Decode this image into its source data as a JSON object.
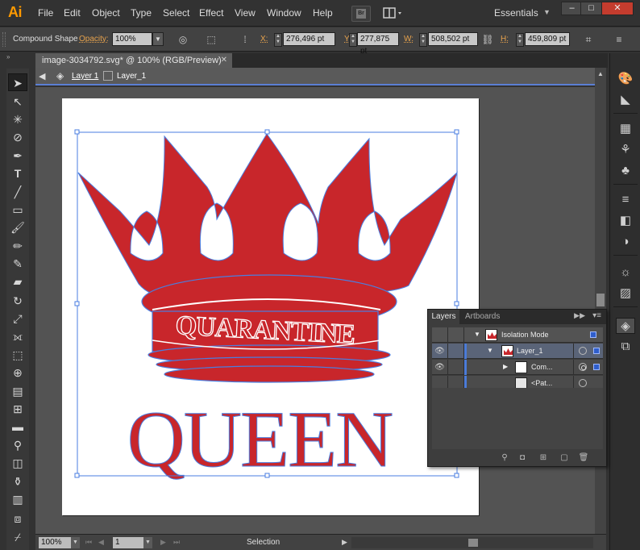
{
  "app": {
    "logo": "Ai"
  },
  "menu": [
    "File",
    "Edit",
    "Object",
    "Type",
    "Select",
    "Effect",
    "View",
    "Window",
    "Help"
  ],
  "bridge_button": "Br",
  "workspace": "Essentials",
  "window_controls": {
    "minimize": "–",
    "maximize": "□",
    "close": "✕"
  },
  "control": {
    "selection_type": "Compound Shape",
    "opacity_label": "Opacity:",
    "opacity_value": "100%",
    "x_label": "X:",
    "x_value": "276,496 pt",
    "y_label": "Y:",
    "y_value": "277,875 pt",
    "w_label": "W:",
    "w_value": "508,502 pt",
    "h_label": "H:",
    "h_value": "459,809 pt"
  },
  "document": {
    "tab_title": "image-3034792.svg* @ 100% (RGB/Preview)"
  },
  "isolation": {
    "layer": "Layer 1",
    "sublayer": "Layer_1"
  },
  "artwork": {
    "crown_text": "QUARANTINE",
    "main_text": "QUEEN",
    "fill_color": "#c8262b",
    "path_color": "#4a7ee0"
  },
  "status": {
    "zoom": "100%",
    "page": "1",
    "tool": "Selection"
  },
  "layers_panel": {
    "tabs": [
      "Layers",
      "Artboards"
    ],
    "rows": [
      {
        "name": "Isolation Mode"
      },
      {
        "name": "Layer_1"
      },
      {
        "name": "Com..."
      },
      {
        "name": "<Pat..."
      }
    ]
  }
}
